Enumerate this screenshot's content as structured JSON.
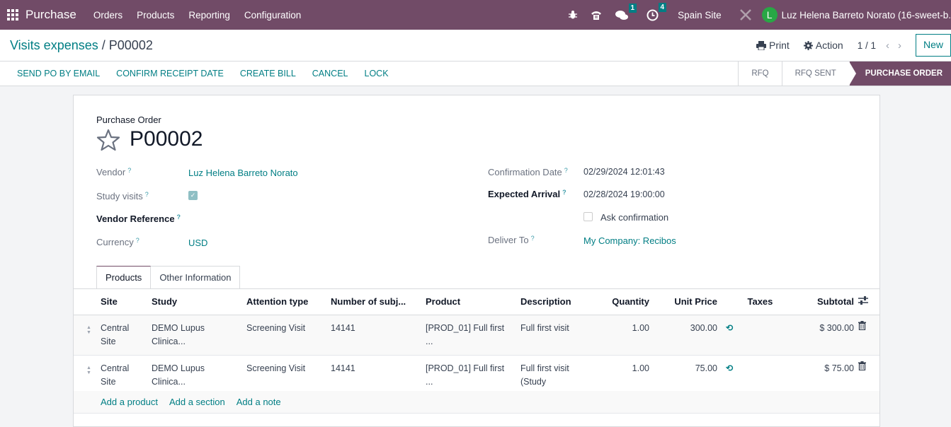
{
  "topbar": {
    "app_name": "Purchase",
    "menus": [
      "Orders",
      "Products",
      "Reporting",
      "Configuration"
    ],
    "icons": {
      "debug": "bug-icon",
      "phone": "phone-icon",
      "messages": "chat-icon",
      "activities": "clock-icon",
      "settings": "tools-icon"
    },
    "messages_count": "1",
    "activities_count": "4",
    "company": "Spain Site",
    "user_initial": "L",
    "user_name": "Luz Helena Barreto Norato (16-sweet-b."
  },
  "control_panel": {
    "breadcrumb_parent": "Visits expenses",
    "breadcrumb_sep": "/",
    "breadcrumb_current": "P00002",
    "print_label": "Print",
    "action_label": "Action",
    "pager": "1 / 1",
    "new_label": "New"
  },
  "actions": [
    "SEND PO BY EMAIL",
    "CONFIRM RECEIPT DATE",
    "CREATE BILL",
    "CANCEL",
    "LOCK"
  ],
  "statusbar": [
    "RFQ",
    "RFQ SENT",
    "PURCHASE ORDER"
  ],
  "form": {
    "subtitle": "Purchase Order",
    "name": "P00002",
    "help": "?",
    "vendor_label": "Vendor",
    "vendor_value": "Luz Helena Barreto Norato",
    "study_visits_label": "Study visits",
    "study_visits_checked": true,
    "vendor_ref_label": "Vendor Reference",
    "currency_label": "Currency",
    "currency_value": "USD",
    "confirmation_date_label": "Confirmation Date",
    "confirmation_date_value": "02/29/2024 12:01:43",
    "expected_arrival_label": "Expected Arrival",
    "expected_arrival_value": "02/28/2024 19:00:00",
    "ask_confirmation_label": "Ask confirmation",
    "ask_confirmation_checked": false,
    "deliver_to_label": "Deliver To",
    "deliver_to_value": "My Company: Recibos"
  },
  "tabs": [
    "Products",
    "Other Information"
  ],
  "table": {
    "headers": [
      "Site",
      "Study",
      "Attention type",
      "Number of subj...",
      "Product",
      "Description",
      "Quantity",
      "Unit Price",
      "Taxes",
      "Subtotal"
    ],
    "rows": [
      {
        "site": "Central Site",
        "study": "DEMO Lupus Clinica...",
        "attention": "Screening Visit",
        "subjects": "14141",
        "product": "[PROD_01] Full first ...",
        "description": "Full first visit",
        "quantity": "1.00",
        "unit_price": "300.00",
        "taxes": "",
        "subtotal": "$ 300.00"
      },
      {
        "site": "Central Site",
        "study": "DEMO Lupus Clinica...",
        "attention": "Screening Visit",
        "subjects": "14141",
        "product": "[PROD_01] Full first ...",
        "description": "Full first visit (Study Coordinator)",
        "quantity": "1.00",
        "unit_price": "75.00",
        "taxes": "",
        "subtotal": "$ 75.00"
      }
    ],
    "add_links": [
      "Add a product",
      "Add a section",
      "Add a note"
    ]
  }
}
